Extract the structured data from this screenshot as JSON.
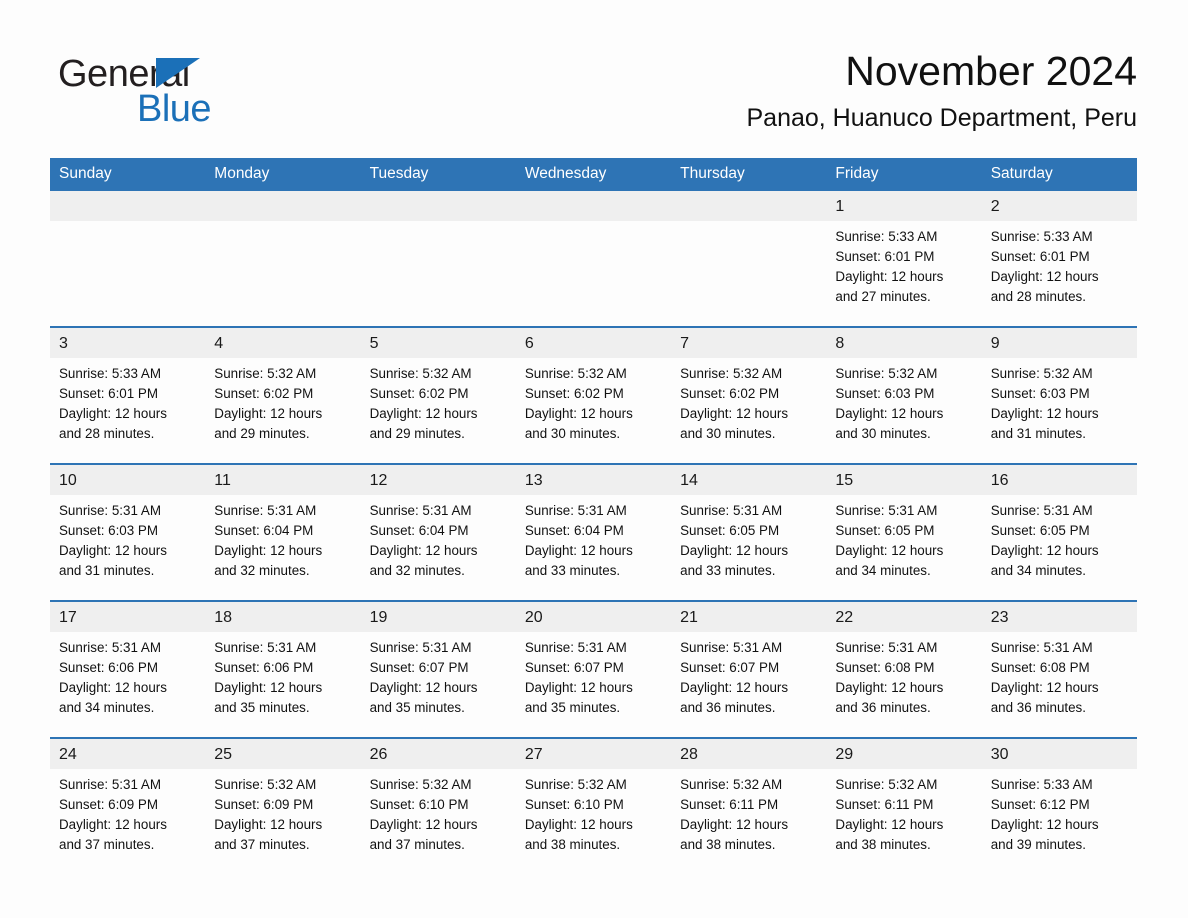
{
  "brand": {
    "word1": "General",
    "word2": "Blue"
  },
  "header": {
    "month_year": "November 2024",
    "location": "Panao, Huanuco Department, Peru"
  },
  "colors": {
    "header_blue": "#2e74b5",
    "logo_blue": "#1b70b8",
    "daynum_band": "#efefef",
    "page_background": "#fdfdfd",
    "text": "#111111"
  },
  "calendar": {
    "weekday_headers": [
      "Sunday",
      "Monday",
      "Tuesday",
      "Wednesday",
      "Thursday",
      "Friday",
      "Saturday"
    ],
    "labels": {
      "sunrise_prefix": "Sunrise:",
      "sunset_prefix": "Sunset:",
      "daylight_prefix": "Daylight:"
    },
    "weeks": [
      [
        null,
        null,
        null,
        null,
        null,
        {
          "day": "1",
          "sunrise": "Sunrise: 5:33 AM",
          "sunset": "Sunset: 6:01 PM",
          "daylight_line1": "Daylight: 12 hours",
          "daylight_line2": "and 27 minutes."
        },
        {
          "day": "2",
          "sunrise": "Sunrise: 5:33 AM",
          "sunset": "Sunset: 6:01 PM",
          "daylight_line1": "Daylight: 12 hours",
          "daylight_line2": "and 28 minutes."
        }
      ],
      [
        {
          "day": "3",
          "sunrise": "Sunrise: 5:33 AM",
          "sunset": "Sunset: 6:01 PM",
          "daylight_line1": "Daylight: 12 hours",
          "daylight_line2": "and 28 minutes."
        },
        {
          "day": "4",
          "sunrise": "Sunrise: 5:32 AM",
          "sunset": "Sunset: 6:02 PM",
          "daylight_line1": "Daylight: 12 hours",
          "daylight_line2": "and 29 minutes."
        },
        {
          "day": "5",
          "sunrise": "Sunrise: 5:32 AM",
          "sunset": "Sunset: 6:02 PM",
          "daylight_line1": "Daylight: 12 hours",
          "daylight_line2": "and 29 minutes."
        },
        {
          "day": "6",
          "sunrise": "Sunrise: 5:32 AM",
          "sunset": "Sunset: 6:02 PM",
          "daylight_line1": "Daylight: 12 hours",
          "daylight_line2": "and 30 minutes."
        },
        {
          "day": "7",
          "sunrise": "Sunrise: 5:32 AM",
          "sunset": "Sunset: 6:02 PM",
          "daylight_line1": "Daylight: 12 hours",
          "daylight_line2": "and 30 minutes."
        },
        {
          "day": "8",
          "sunrise": "Sunrise: 5:32 AM",
          "sunset": "Sunset: 6:03 PM",
          "daylight_line1": "Daylight: 12 hours",
          "daylight_line2": "and 30 minutes."
        },
        {
          "day": "9",
          "sunrise": "Sunrise: 5:32 AM",
          "sunset": "Sunset: 6:03 PM",
          "daylight_line1": "Daylight: 12 hours",
          "daylight_line2": "and 31 minutes."
        }
      ],
      [
        {
          "day": "10",
          "sunrise": "Sunrise: 5:31 AM",
          "sunset": "Sunset: 6:03 PM",
          "daylight_line1": "Daylight: 12 hours",
          "daylight_line2": "and 31 minutes."
        },
        {
          "day": "11",
          "sunrise": "Sunrise: 5:31 AM",
          "sunset": "Sunset: 6:04 PM",
          "daylight_line1": "Daylight: 12 hours",
          "daylight_line2": "and 32 minutes."
        },
        {
          "day": "12",
          "sunrise": "Sunrise: 5:31 AM",
          "sunset": "Sunset: 6:04 PM",
          "daylight_line1": "Daylight: 12 hours",
          "daylight_line2": "and 32 minutes."
        },
        {
          "day": "13",
          "sunrise": "Sunrise: 5:31 AM",
          "sunset": "Sunset: 6:04 PM",
          "daylight_line1": "Daylight: 12 hours",
          "daylight_line2": "and 33 minutes."
        },
        {
          "day": "14",
          "sunrise": "Sunrise: 5:31 AM",
          "sunset": "Sunset: 6:05 PM",
          "daylight_line1": "Daylight: 12 hours",
          "daylight_line2": "and 33 minutes."
        },
        {
          "day": "15",
          "sunrise": "Sunrise: 5:31 AM",
          "sunset": "Sunset: 6:05 PM",
          "daylight_line1": "Daylight: 12 hours",
          "daylight_line2": "and 34 minutes."
        },
        {
          "day": "16",
          "sunrise": "Sunrise: 5:31 AM",
          "sunset": "Sunset: 6:05 PM",
          "daylight_line1": "Daylight: 12 hours",
          "daylight_line2": "and 34 minutes."
        }
      ],
      [
        {
          "day": "17",
          "sunrise": "Sunrise: 5:31 AM",
          "sunset": "Sunset: 6:06 PM",
          "daylight_line1": "Daylight: 12 hours",
          "daylight_line2": "and 34 minutes."
        },
        {
          "day": "18",
          "sunrise": "Sunrise: 5:31 AM",
          "sunset": "Sunset: 6:06 PM",
          "daylight_line1": "Daylight: 12 hours",
          "daylight_line2": "and 35 minutes."
        },
        {
          "day": "19",
          "sunrise": "Sunrise: 5:31 AM",
          "sunset": "Sunset: 6:07 PM",
          "daylight_line1": "Daylight: 12 hours",
          "daylight_line2": "and 35 minutes."
        },
        {
          "day": "20",
          "sunrise": "Sunrise: 5:31 AM",
          "sunset": "Sunset: 6:07 PM",
          "daylight_line1": "Daylight: 12 hours",
          "daylight_line2": "and 35 minutes."
        },
        {
          "day": "21",
          "sunrise": "Sunrise: 5:31 AM",
          "sunset": "Sunset: 6:07 PM",
          "daylight_line1": "Daylight: 12 hours",
          "daylight_line2": "and 36 minutes."
        },
        {
          "day": "22",
          "sunrise": "Sunrise: 5:31 AM",
          "sunset": "Sunset: 6:08 PM",
          "daylight_line1": "Daylight: 12 hours",
          "daylight_line2": "and 36 minutes."
        },
        {
          "day": "23",
          "sunrise": "Sunrise: 5:31 AM",
          "sunset": "Sunset: 6:08 PM",
          "daylight_line1": "Daylight: 12 hours",
          "daylight_line2": "and 36 minutes."
        }
      ],
      [
        {
          "day": "24",
          "sunrise": "Sunrise: 5:31 AM",
          "sunset": "Sunset: 6:09 PM",
          "daylight_line1": "Daylight: 12 hours",
          "daylight_line2": "and 37 minutes."
        },
        {
          "day": "25",
          "sunrise": "Sunrise: 5:32 AM",
          "sunset": "Sunset: 6:09 PM",
          "daylight_line1": "Daylight: 12 hours",
          "daylight_line2": "and 37 minutes."
        },
        {
          "day": "26",
          "sunrise": "Sunrise: 5:32 AM",
          "sunset": "Sunset: 6:10 PM",
          "daylight_line1": "Daylight: 12 hours",
          "daylight_line2": "and 37 minutes."
        },
        {
          "day": "27",
          "sunrise": "Sunrise: 5:32 AM",
          "sunset": "Sunset: 6:10 PM",
          "daylight_line1": "Daylight: 12 hours",
          "daylight_line2": "and 38 minutes."
        },
        {
          "day": "28",
          "sunrise": "Sunrise: 5:32 AM",
          "sunset": "Sunset: 6:11 PM",
          "daylight_line1": "Daylight: 12 hours",
          "daylight_line2": "and 38 minutes."
        },
        {
          "day": "29",
          "sunrise": "Sunrise: 5:32 AM",
          "sunset": "Sunset: 6:11 PM",
          "daylight_line1": "Daylight: 12 hours",
          "daylight_line2": "and 38 minutes."
        },
        {
          "day": "30",
          "sunrise": "Sunrise: 5:33 AM",
          "sunset": "Sunset: 6:12 PM",
          "daylight_line1": "Daylight: 12 hours",
          "daylight_line2": "and 39 minutes."
        }
      ]
    ]
  }
}
